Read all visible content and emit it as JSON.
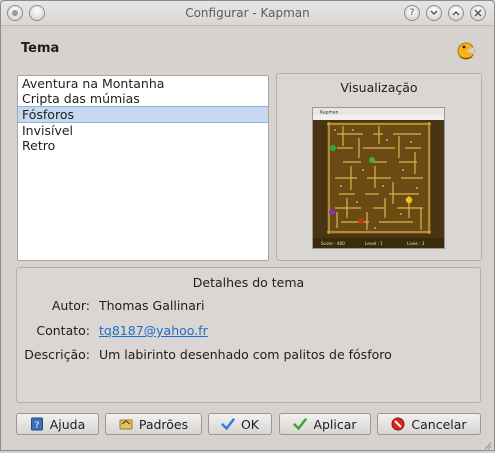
{
  "window": {
    "title": "Configurar - Kapman",
    "controls": [
      "help-icon",
      "minimize-icon",
      "maximize-icon",
      "close-icon"
    ]
  },
  "page": {
    "heading": "Tema",
    "heading_icon": "kapman-icon"
  },
  "themes": {
    "items": [
      {
        "label": "Aventura na Montanha",
        "selected": false
      },
      {
        "label": "Cripta das múmias",
        "selected": false
      },
      {
        "label": "Fósforos",
        "selected": true
      },
      {
        "label": "Invisível",
        "selected": false
      },
      {
        "label": "Retro",
        "selected": false
      }
    ]
  },
  "preview": {
    "title": "Visualização",
    "thumbnail_texts": {
      "app_title": "Kapman",
      "score": "Score : 400",
      "level": "Level : 1",
      "lives": "Lives : 3"
    }
  },
  "details": {
    "title": "Detalhes do tema",
    "author_label": "Autor:",
    "author_value": "Thomas Gallinari",
    "contact_label": "Contato:",
    "contact_value": "tq8187@yahoo.fr",
    "description_label": "Descrição:",
    "description_value": "Um labirinto desenhado com palitos de fósforo"
  },
  "buttons": {
    "help": "Ajuda",
    "defaults": "Padrões",
    "ok": "OK",
    "apply": "Aplicar",
    "cancel": "Cancelar"
  },
  "colors": {
    "selection": "#c5d9f0",
    "link": "#1f6fc9",
    "ok_check": "#2a7de1",
    "apply_check": "#3aa52e",
    "cancel_red": "#d8251f"
  }
}
